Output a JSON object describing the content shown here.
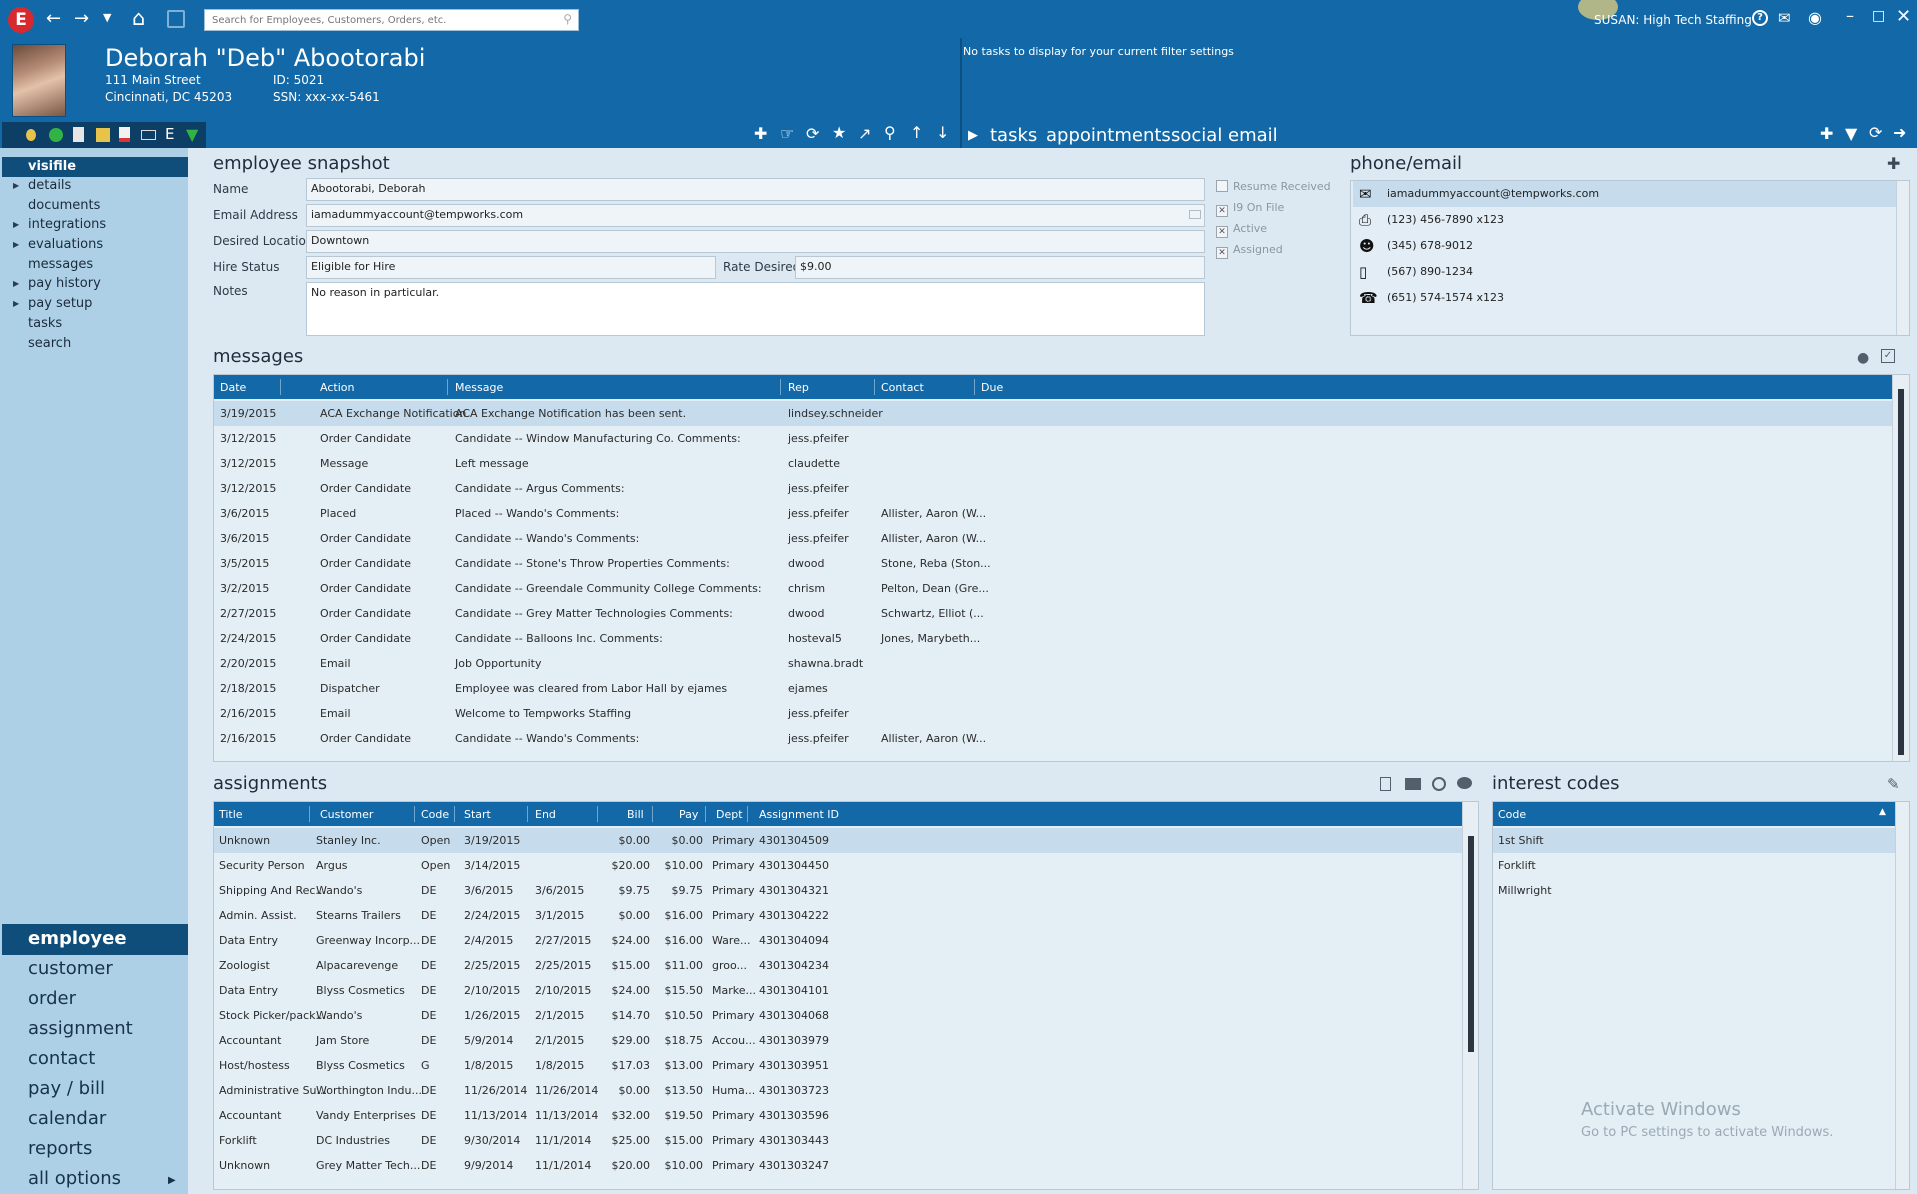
{
  "app": {
    "logo": "E",
    "search_placeholder": "Search for Employees, Customers, Orders, etc.",
    "user_label": "SUSAN: High Tech Staffing",
    "activation_title": "Activate Windows",
    "activation_sub": "Go to PC settings to activate Windows."
  },
  "header": {
    "name": "Deborah \"Deb\" Abootorabi",
    "address1": "111 Main Street",
    "address2": "Cincinnati, DC 45203",
    "id": "ID: 5021",
    "ssn": "SSN: xxx-xx-5461",
    "tasks_empty": "No tasks to display for your current filter settings",
    "tabs": [
      "tasks",
      "appointments",
      "social",
      "email"
    ]
  },
  "leftnav": {
    "items": [
      "visifile",
      "details",
      "documents",
      "integrations",
      "evaluations",
      "messages",
      "pay history",
      "pay setup",
      "tasks",
      "search"
    ],
    "sections": [
      "employee",
      "customer",
      "order",
      "assignment",
      "contact",
      "pay / bill",
      "calendar",
      "reports",
      "all options"
    ]
  },
  "snapshot": {
    "title": "employee snapshot",
    "labels": {
      "name": "Name",
      "email": "Email Address",
      "location": "Desired Location",
      "hire_status": "Hire Status",
      "rate": "Rate Desired",
      "notes": "Notes"
    },
    "values": {
      "name": "Abootorabi, Deborah",
      "email": "iamadummyaccount@tempworks.com",
      "location": "Downtown",
      "hire_status": "Eligible for Hire",
      "rate": "$9.00",
      "notes": "No reason in particular."
    },
    "checks": [
      {
        "label": "Resume Received",
        "checked": false
      },
      {
        "label": "I9 On File",
        "checked": true
      },
      {
        "label": "Active",
        "checked": true
      },
      {
        "label": "Assigned",
        "checked": true
      }
    ]
  },
  "phone_email": {
    "title": "phone/email",
    "entries": [
      {
        "icon": "envelope-icon",
        "text": "iamadummyaccount@tempworks.com"
      },
      {
        "icon": "fax-icon",
        "text": "(123) 456-7890 x123"
      },
      {
        "icon": "person-icon",
        "text": "(345) 678-9012"
      },
      {
        "icon": "mobile-icon",
        "text": "(567) 890-1234"
      },
      {
        "icon": "phone-icon",
        "text": "(651) 574-1574 x123"
      }
    ]
  },
  "messages": {
    "title": "messages",
    "columns": [
      "Date",
      "Action",
      "Message",
      "Rep",
      "Contact",
      "Due"
    ],
    "rows": [
      [
        "3/19/2015",
        "ACA Exchange Notification",
        "ACA Exchange Notification has been sent.",
        "lindsey.schneider",
        "",
        ""
      ],
      [
        "3/12/2015",
        "Order Candidate",
        "Candidate  --  Window Manufacturing Co.    Comments:",
        "jess.pfeifer",
        "",
        ""
      ],
      [
        "3/12/2015",
        "Message",
        "Left message",
        "claudette",
        "",
        ""
      ],
      [
        "3/12/2015",
        "Order Candidate",
        "Candidate  --  Argus    Comments:",
        "jess.pfeifer",
        "",
        ""
      ],
      [
        "3/6/2015",
        "Placed",
        "Placed  --  Wando's    Comments:",
        "jess.pfeifer",
        "Allister, Aaron (W...",
        ""
      ],
      [
        "3/6/2015",
        "Order Candidate",
        "Candidate  --  Wando's    Comments:",
        "jess.pfeifer",
        "Allister, Aaron (W...",
        ""
      ],
      [
        "3/5/2015",
        "Order Candidate",
        "Candidate  --  Stone's Throw Properties    Comments:",
        "dwood",
        "Stone, Reba (Ston...",
        ""
      ],
      [
        "3/2/2015",
        "Order Candidate",
        "Candidate  --  Greendale Community College    Comments:",
        "chrism",
        "Pelton, Dean (Gre...",
        ""
      ],
      [
        "2/27/2015",
        "Order Candidate",
        "Candidate  --  Grey Matter Technologies    Comments:",
        "dwood",
        "Schwartz, Elliot (...",
        ""
      ],
      [
        "2/24/2015",
        "Order Candidate",
        "Candidate  --  Balloons Inc.    Comments:",
        "hosteval5",
        "Jones, Marybeth...",
        ""
      ],
      [
        "2/20/2015",
        "Email",
        "Job Opportunity",
        "shawna.bradt",
        "",
        ""
      ],
      [
        "2/18/2015",
        "Dispatcher",
        "Employee was cleared from Labor Hall by ejames",
        "ejames",
        "",
        ""
      ],
      [
        "2/16/2015",
        "Email",
        "Welcome to Tempworks Staffing",
        "jess.pfeifer",
        "",
        ""
      ],
      [
        "2/16/2015",
        "Order Candidate",
        "Candidate  --  Wando's    Comments:",
        "jess.pfeifer",
        "Allister, Aaron (W...",
        ""
      ]
    ]
  },
  "assignments": {
    "title": "assignments",
    "columns": [
      "Title",
      "Customer",
      "Code",
      "Start",
      "End",
      "Bill",
      "Pay",
      "Dept",
      "Assignment ID"
    ],
    "rows": [
      [
        "Unknown",
        "Stanley Inc.",
        "Open",
        "3/19/2015",
        "",
        "$0.00",
        "$0.00",
        "Primary",
        "4301304509"
      ],
      [
        "Security Person",
        "Argus",
        "Open",
        "3/14/2015",
        "",
        "$20.00",
        "$10.00",
        "Primary",
        "4301304450"
      ],
      [
        "Shipping And Rec...",
        "Wando's",
        "DE",
        "3/6/2015",
        "3/6/2015",
        "$9.75",
        "$9.75",
        "Primary",
        "4301304321"
      ],
      [
        "Admin. Assist.",
        "Stearns Trailers",
        "DE",
        "2/24/2015",
        "3/1/2015",
        "$0.00",
        "$16.00",
        "Primary",
        "4301304222"
      ],
      [
        "Data Entry",
        "Greenway Incorp...",
        "DE",
        "2/4/2015",
        "2/27/2015",
        "$24.00",
        "$16.00",
        "Ware...",
        "4301304094"
      ],
      [
        "Zoologist",
        "Alpacarevenge",
        "DE",
        "2/25/2015",
        "2/25/2015",
        "$15.00",
        "$11.00",
        "groo...",
        "4301304234"
      ],
      [
        "Data Entry",
        "Blyss Cosmetics",
        "DE",
        "2/10/2015",
        "2/10/2015",
        "$24.00",
        "$15.50",
        "Marke...",
        "4301304101"
      ],
      [
        "Stock Picker/pack...",
        "Wando's",
        "DE",
        "1/26/2015",
        "2/1/2015",
        "$14.70",
        "$10.50",
        "Primary",
        "4301304068"
      ],
      [
        "Accountant",
        "Jam Store",
        "DE",
        "5/9/2014",
        "2/1/2015",
        "$29.00",
        "$18.75",
        "Accou...",
        "4301303979"
      ],
      [
        "Host/hostess",
        "Blyss Cosmetics",
        "G",
        "1/8/2015",
        "1/8/2015",
        "$17.03",
        "$13.00",
        "Primary",
        "4301303951"
      ],
      [
        "Administrative Su...",
        "Worthington Indu...",
        "DE",
        "11/26/2014",
        "11/26/2014",
        "$0.00",
        "$13.50",
        "Huma...",
        "4301303723"
      ],
      [
        "Accountant",
        "Vandy Enterprises",
        "DE",
        "11/13/2014",
        "11/13/2014",
        "$32.00",
        "$19.50",
        "Primary",
        "4301303596"
      ],
      [
        "Forklift",
        "DC Industries",
        "DE",
        "9/30/2014",
        "11/1/2014",
        "$25.00",
        "$15.00",
        "Primary",
        "4301303443"
      ],
      [
        "Unknown",
        "Grey Matter Tech...",
        "DE",
        "9/9/2014",
        "11/1/2014",
        "$20.00",
        "$10.00",
        "Primary",
        "4301303247"
      ]
    ]
  },
  "interest_codes": {
    "title": "interest codes",
    "column": "Code",
    "rows": [
      "1st Shift",
      "Forklift",
      "Millwright"
    ]
  }
}
